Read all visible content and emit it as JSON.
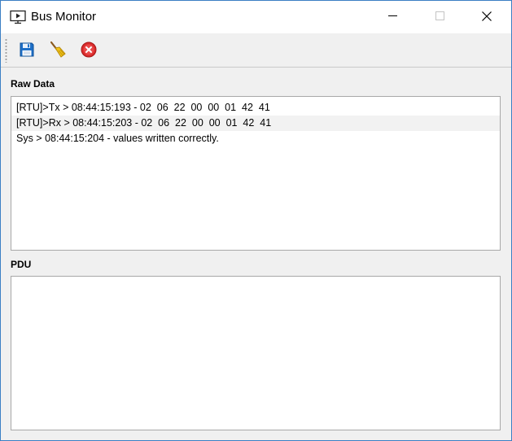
{
  "window": {
    "title": "Bus Monitor",
    "icon": "monitor-play-icon",
    "controls": [
      "minimize",
      "maximize",
      "close"
    ]
  },
  "toolbar": {
    "buttons": [
      {
        "name": "save",
        "icon": "floppy-disk-icon"
      },
      {
        "name": "clear",
        "icon": "broom-icon"
      },
      {
        "name": "stop",
        "icon": "red-x-circle-icon"
      }
    ]
  },
  "raw_data": {
    "label": "Raw Data",
    "lines": [
      "[RTU]>Tx > 08:44:15:193 - 02  06  22  00  00  01  42  41",
      "[RTU]>Rx > 08:44:15:203 - 02  06  22  00  00  01  42  41",
      "Sys > 08:44:15:204 - values written correctly."
    ]
  },
  "pdu": {
    "label": "PDU",
    "lines": []
  },
  "colors": {
    "window_border": "#3b7fc4",
    "toolbar_bg": "#f0f0f0",
    "close_icon_red": "#d92b2b",
    "save_icon_blue": "#1e6fc7"
  }
}
